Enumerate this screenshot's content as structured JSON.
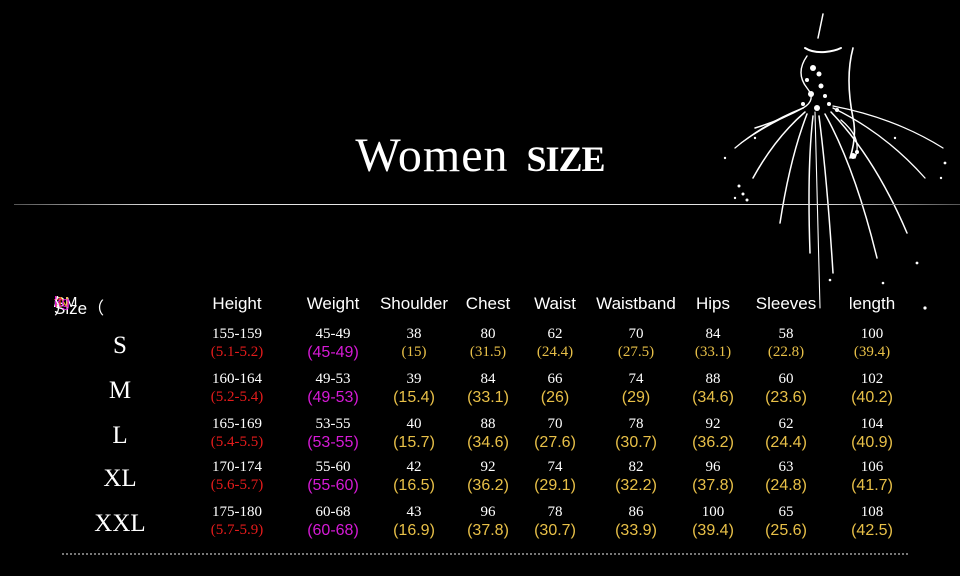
{
  "title": {
    "main": "Women",
    "sub": "SIZE"
  },
  "header": {
    "size_prefix": "Size（",
    "units": [
      {
        "text": "CM",
        "color": "#ffffff"
      },
      {
        "text": "/",
        "color": "#ffffff"
      },
      {
        "text": "IN",
        "color": "#f3a21d"
      },
      {
        "text": "/",
        "color": "#ffffff"
      },
      {
        "text": "ft",
        "color": "#e41b1b"
      },
      {
        "text": "/",
        "color": "#ffffff"
      },
      {
        "text": "kg",
        "color": "#d61ad6"
      }
    ],
    "size_suffix": "）",
    "columns": [
      "Height",
      "Weight",
      "Shoulder",
      "Chest",
      "Waist",
      "Waistband",
      "Hips",
      "Sleeves",
      "length"
    ]
  },
  "colors": {
    "feet": "#e41b1b",
    "kg": "#d61ad6",
    "inches": "#e8c048",
    "text": "#ffffff",
    "background": "#000000"
  },
  "rows": [
    {
      "size": "S",
      "cells": [
        [
          "155-159",
          "(5.1-5.2)"
        ],
        [
          "45-49",
          "(45-49)"
        ],
        [
          "38",
          "(15)"
        ],
        [
          "80",
          "(31.5)"
        ],
        [
          "62",
          "(24.4)"
        ],
        [
          "70",
          "(27.5)"
        ],
        [
          "84",
          "(33.1)"
        ],
        [
          "58",
          "(22.8)"
        ],
        [
          "100",
          "(39.4)"
        ]
      ]
    },
    {
      "size": "M",
      "cells": [
        [
          "160-164",
          "(5.2-5.4)"
        ],
        [
          "49-53",
          "(49-53)"
        ],
        [
          "39",
          "(15.4)"
        ],
        [
          "84",
          "(33.1)"
        ],
        [
          "66",
          "(26)"
        ],
        [
          "74",
          "(29)"
        ],
        [
          "88",
          "(34.6)"
        ],
        [
          "60",
          "(23.6)"
        ],
        [
          "102",
          "(40.2)"
        ]
      ]
    },
    {
      "size": "L",
      "cells": [
        [
          "165-169",
          "(5.4-5.5)"
        ],
        [
          "53-55",
          "(53-55)"
        ],
        [
          "40",
          "(15.7)"
        ],
        [
          "88",
          "(34.6)"
        ],
        [
          "70",
          "(27.6)"
        ],
        [
          "78",
          "(30.7)"
        ],
        [
          "92",
          "(36.2)"
        ],
        [
          "62",
          "(24.4)"
        ],
        [
          "104",
          "(40.9)"
        ]
      ]
    },
    {
      "size": "XL",
      "cells": [
        [
          "170-174",
          "(5.6-5.7)"
        ],
        [
          "55-60",
          "(55-60)"
        ],
        [
          "42",
          "(16.5)"
        ],
        [
          "92",
          "(36.2)"
        ],
        [
          "74",
          "(29.1)"
        ],
        [
          "82",
          "(32.2)"
        ],
        [
          "96",
          "(37.8)"
        ],
        [
          "63",
          "(24.8)"
        ],
        [
          "106",
          "(41.7)"
        ]
      ]
    },
    {
      "size": "XXL",
      "cells": [
        [
          "175-180",
          "(5.7-5.9)"
        ],
        [
          "60-68",
          "(60-68)"
        ],
        [
          "43",
          "(16.9)"
        ],
        [
          "96",
          "(37.8)"
        ],
        [
          "78",
          "(30.7)"
        ],
        [
          "86",
          "(33.9)"
        ],
        [
          "100",
          "(39.4)"
        ],
        [
          "65",
          "(25.6)"
        ],
        [
          "108",
          "(42.5)"
        ]
      ]
    }
  ]
}
